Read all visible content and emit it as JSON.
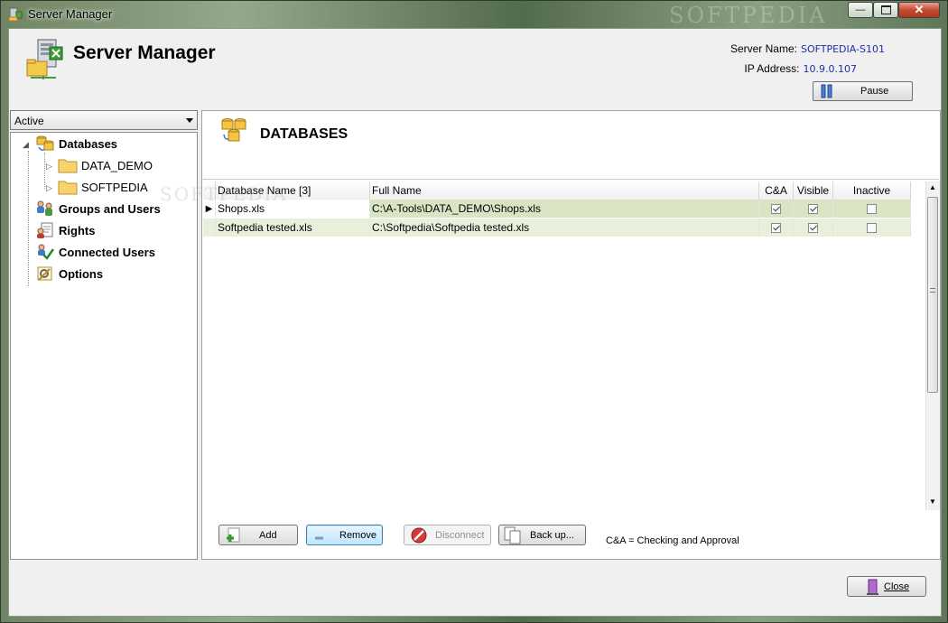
{
  "window": {
    "title": "Server Manager",
    "watermark": "SOFTPEDIA",
    "caption_buttons": [
      "minimize",
      "maximize",
      "close"
    ]
  },
  "header": {
    "app_title": "Server Manager",
    "server_name_label": "Server Name:",
    "server_name_value": "SOFTPEDIA-S101",
    "ip_address_label": "IP Address:",
    "ip_address_value": "10.9.0.107",
    "pause_label": "Pause"
  },
  "sidebar": {
    "filter_value": "Active",
    "tree": [
      {
        "label": "Databases",
        "icon": "database-icon"
      },
      {
        "label": "DATA_DEMO",
        "icon": "folder-icon"
      },
      {
        "label": "SOFTPEDIA",
        "icon": "folder-icon"
      },
      {
        "label": "Groups and Users",
        "icon": "users-icon"
      },
      {
        "label": "Rights",
        "icon": "rights-icon"
      },
      {
        "label": "Connected Users",
        "icon": "connected-users-icon"
      },
      {
        "label": "Options",
        "icon": "options-icon"
      }
    ]
  },
  "main": {
    "section_title": "DATABASES",
    "columns": [
      "Database Name [3]",
      "Full Name",
      "C&A",
      "Visible",
      "Inactive"
    ],
    "rows": [
      {
        "name": "Shops.xls",
        "full_name": "C:\\A-Tools\\DATA_DEMO\\Shops.xls",
        "ca": true,
        "visible": true,
        "inactive": false
      },
      {
        "name": "Softpedia tested.xls",
        "full_name": "C:\\Softpedia\\Softpedia tested.xls",
        "ca": true,
        "visible": true,
        "inactive": false
      }
    ],
    "grid_watermark": "SOFTPEDIA",
    "buttons": {
      "add": "Add",
      "remove": "Remove",
      "disconnect": "Disconnect",
      "backup": "Back up..."
    },
    "legend_note": "C&A = Checking and Approval"
  },
  "footer": {
    "close_label": "Close"
  },
  "colors": {
    "row_highlight": "#d8e4c4",
    "row_alt": "#e8f0dc",
    "link_blue": "#1e2ea8"
  }
}
